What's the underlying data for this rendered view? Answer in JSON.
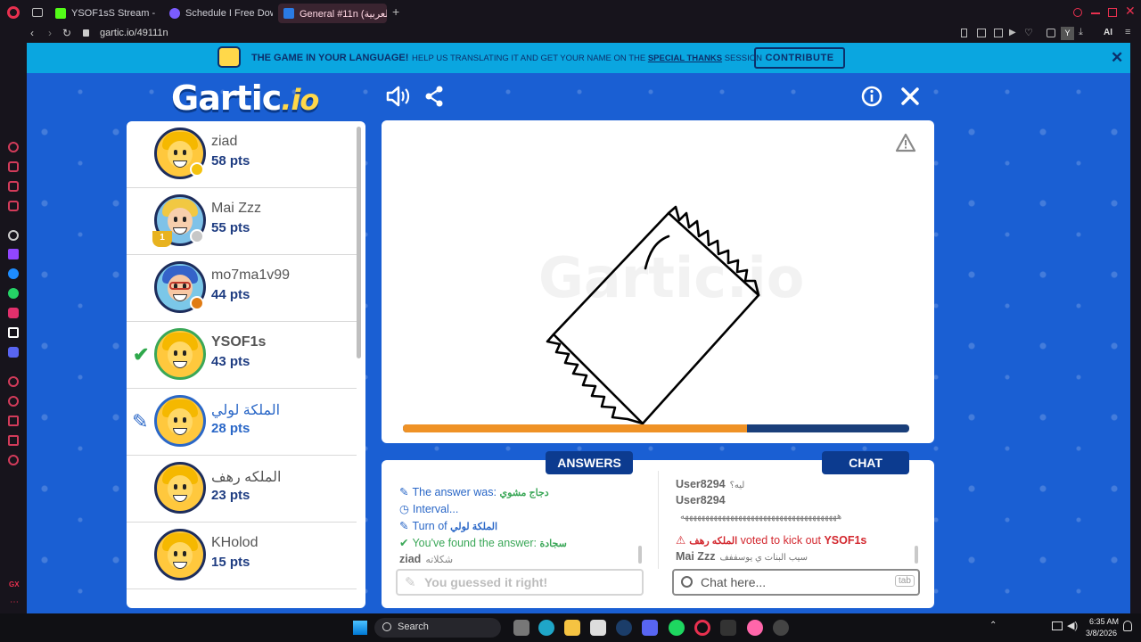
{
  "browser": {
    "tabs": [
      {
        "title": "YSOF1sS Stream - Kick Da",
        "color": "#53fc18"
      },
      {
        "title": "Schedule I Free Download",
        "color": "#7b5cff"
      },
      {
        "title": "General #11n (العربية) - Gar",
        "color": "#2a7be4"
      }
    ],
    "url": "gartic.io/49111n",
    "toolbar_label": "AI",
    "profile_letter": "Y",
    "sidebar_label": "GX"
  },
  "banner": {
    "title": "THE GAME IN YOUR LANGUAGE!",
    "text": "HELP US TRANSLATING IT AND GET YOUR NAME ON THE",
    "link": "SPECIAL THANKS",
    "suffix": "SESSION",
    "button": "CONTRIBUTE"
  },
  "logo": {
    "main": "Gartic",
    "suffix": ".io"
  },
  "players": [
    {
      "name": "ziad",
      "points": "58 pts",
      "badge_color": "#f4c20d",
      "name_color": "#555555",
      "avatar_style": "blond-boy"
    },
    {
      "name": "Mai Zzz",
      "points": "55 pts",
      "badge_color": "#c7c7c7",
      "name_color": "#555555",
      "avatar_style": "blonde-girl",
      "trophy": "1"
    },
    {
      "name": "mo7ma1v99",
      "points": "44 pts",
      "badge_color": "#e07b14",
      "name_color": "#555555",
      "avatar_style": "curly-glasses"
    },
    {
      "name": "YSOF1s",
      "points": "43 pts",
      "badge_color": "",
      "name_color": "#555555",
      "avatar_style": "blond-boy",
      "status": "check",
      "highlight": "#3aa757"
    },
    {
      "name": "الملكة لولي",
      "points": "28 pts",
      "badge_color": "",
      "name_color": "#2a67c7",
      "avatar_style": "blond-boy",
      "status": "pencil",
      "highlight": "#2a67c7"
    },
    {
      "name": "الملكه رهف",
      "points": "23 pts",
      "badge_color": "",
      "name_color": "#555555",
      "avatar_style": "blond-boy"
    },
    {
      "name": "KHolod",
      "points": "15 pts",
      "badge_color": "",
      "name_color": "#555555",
      "avatar_style": "blond-boy"
    }
  ],
  "canvas": {
    "watermark": "Gartic.io",
    "timer_progress": 0.68
  },
  "answers": {
    "tab": "ANSWERS",
    "lines": [
      {
        "text": "The answer was: ",
        "emph": "دجاج مشوي",
        "icon": "pencil-icon",
        "color": "#2a67c7",
        "emph_color": "#3aa757"
      },
      {
        "text": "Interval...",
        "emph": "",
        "icon": "clock-icon",
        "color": "#2a67c7",
        "emph_color": "#3aa757"
      },
      {
        "text": "Turn of ",
        "emph": "الملكة لولي",
        "icon": "pencil-icon",
        "color": "#2a67c7",
        "emph_color": "#2a67c7"
      },
      {
        "text": "You've found the answer: ",
        "emph": "سجادة",
        "icon": "check-icon",
        "color": "#3aa757",
        "emph_color": "#3aa757"
      },
      {
        "user": "ziad",
        "msg": "شكلاته"
      }
    ],
    "input_placeholder": "You guessed it right!"
  },
  "chat": {
    "tab": "CHAT",
    "lines": [
      {
        "user": "User8294",
        "msg": "ليه؟"
      },
      {
        "user": "User8294",
        "msg": ""
      },
      {
        "user": "",
        "msg": "ههههههههههههههههههههههههههههههههههههههه"
      },
      {
        "kick_user": "الملكه رهف",
        "kick_text": " voted to kick out ",
        "kick_target": "YSOF1s"
      },
      {
        "user": "Mai Zzz",
        "msg": "سيب البنات ي يوسففف"
      }
    ],
    "input_placeholder": "Chat here...",
    "input_hint": "tab"
  },
  "taskbar": {
    "search": "Search",
    "time": "6:35 AM",
    "date": "3/8/2026"
  }
}
